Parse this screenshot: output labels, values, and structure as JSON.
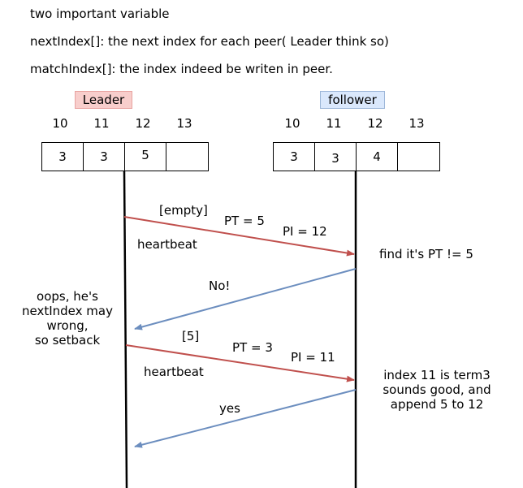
{
  "intro": {
    "line1": "two important variable",
    "line2": "nextIndex[]:  the next index for each peer( Leader think so)",
    "line3": "matchIndex[]: the index indeed be writen in peer."
  },
  "leader": {
    "label": "Leader",
    "indices": [
      "10",
      "11",
      "12",
      "13"
    ],
    "entries": [
      "3",
      "3",
      "5",
      ""
    ]
  },
  "follower": {
    "label": "follower",
    "indices": [
      "10",
      "11",
      "12",
      "13"
    ],
    "entries": [
      "3",
      "3",
      "4",
      ""
    ]
  },
  "messages": {
    "msg1_entries": "[empty]",
    "msg1_pt": "PT = 5",
    "msg1_pi": "PI = 12",
    "msg1_type": "heartbeat",
    "reply1": "No!",
    "msg2_entries": "[5]",
    "msg2_pt": "PT = 3",
    "msg2_pi": "PI = 11",
    "msg2_type": "heartbeat",
    "reply2": "yes"
  },
  "notes": {
    "follower1": "find it's PT != 5",
    "leader_lines": [
      "oops, he's",
      "nextIndex may",
      "wrong,",
      "so setback"
    ],
    "follower2_lines": [
      "index 11 is term3",
      "sounds good, and",
      "append 5 to 12"
    ]
  },
  "colors": {
    "request_arrow": "#c0504d",
    "reply_arrow": "#6c8ebf",
    "leader_fill": "#f8cecc",
    "follower_fill": "#dae8fc"
  }
}
